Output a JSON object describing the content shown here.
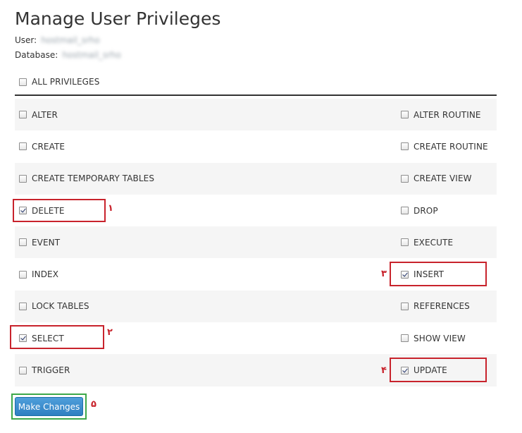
{
  "title": "Manage User Privileges",
  "user_label": "User:",
  "user_value": "hostmail_srho",
  "database_label": "Database:",
  "database_value": "hostmail_srho",
  "all_privileges": {
    "label": "ALL PRIVILEGES",
    "checked": false
  },
  "privileges": [
    {
      "left": {
        "label": "ALTER",
        "checked": false
      },
      "right": {
        "label": "ALTER ROUTINE",
        "checked": false
      }
    },
    {
      "left": {
        "label": "CREATE",
        "checked": false
      },
      "right": {
        "label": "CREATE ROUTINE",
        "checked": false
      }
    },
    {
      "left": {
        "label": "CREATE TEMPORARY TABLES",
        "checked": false
      },
      "right": {
        "label": "CREATE VIEW",
        "checked": false
      }
    },
    {
      "left": {
        "label": "DELETE",
        "checked": true
      },
      "right": {
        "label": "DROP",
        "checked": false
      }
    },
    {
      "left": {
        "label": "EVENT",
        "checked": false
      },
      "right": {
        "label": "EXECUTE",
        "checked": false
      }
    },
    {
      "left": {
        "label": "INDEX",
        "checked": false
      },
      "right": {
        "label": "INSERT",
        "checked": true
      }
    },
    {
      "left": {
        "label": "LOCK TABLES",
        "checked": false
      },
      "right": {
        "label": "REFERENCES",
        "checked": false
      }
    },
    {
      "left": {
        "label": "SELECT",
        "checked": true
      },
      "right": {
        "label": "SHOW VIEW",
        "checked": false
      }
    },
    {
      "left": {
        "label": "TRIGGER",
        "checked": false
      },
      "right": {
        "label": "UPDATE",
        "checked": true
      }
    }
  ],
  "annotations": [
    "١",
    "٢",
    "٣",
    "۴",
    "۵"
  ],
  "submit_label": "Make Changes",
  "colors": {
    "highlight": "#c8232c",
    "button_highlight": "#3da84a",
    "button": "#337ab7"
  }
}
